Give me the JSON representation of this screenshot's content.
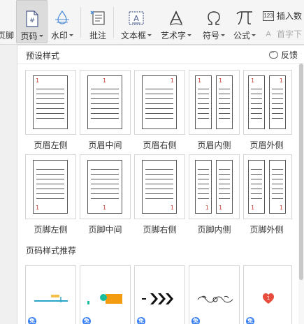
{
  "ribbon": {
    "partial_left": "页脚",
    "page_number": "页码",
    "watermark": "水印",
    "comment": "批注",
    "textbox": "文本框",
    "wordart": "艺术字",
    "symbol": "符号",
    "formula": "公式",
    "insert_number": "插入数",
    "first_char": "首字下"
  },
  "panel": {
    "preset_title": "预设样式",
    "feedback": "反馈",
    "recommend_title": "页码样式推荐",
    "header_presets": [
      "页眉左侧",
      "页眉中间",
      "页眉右侧",
      "页眉内侧",
      "页眉外侧"
    ],
    "footer_presets": [
      "页脚左侧",
      "页脚中间",
      "页脚右侧",
      "页脚内侧",
      "页脚外侧"
    ],
    "page_marker": "1",
    "badge_label": "免"
  },
  "colors": {
    "page_number_red": "#c0392b",
    "accent_blue": "#3b82f6",
    "orange": "#f39c12",
    "teal": "#1abc9c",
    "heart_red": "#e74c3c"
  }
}
